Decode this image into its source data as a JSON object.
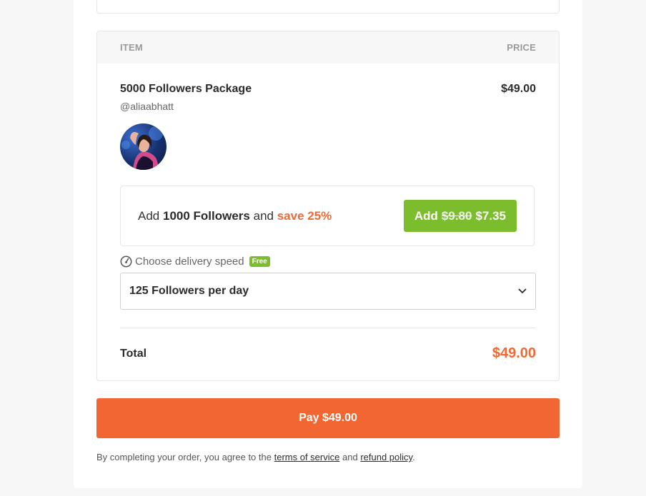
{
  "order": {
    "header": {
      "item_label": "ITEM",
      "price_label": "PRICE"
    },
    "item": {
      "name": "5000 Followers Package",
      "handle": "@aliaabhatt",
      "price": "$49.00"
    },
    "upsell": {
      "prefix": "Add",
      "amount": "1000 Followers",
      "middle": "and",
      "save": "save 25%",
      "button_prefix": "Add",
      "old_price": "$9.80",
      "new_price": "$7.35"
    },
    "delivery": {
      "label": "Choose delivery speed",
      "badge": "Free",
      "selected": "125 Followers per day"
    },
    "total": {
      "label": "Total",
      "value": "$49.00"
    }
  },
  "pay_button": "Pay $49.00",
  "legal": {
    "prefix": "By completing your order, you agree to the",
    "terms": "terms of service",
    "and": "and",
    "refund": "refund policy",
    "suffix": "."
  },
  "colors": {
    "accent_orange": "#f26731",
    "accent_green": "#7cbd2d",
    "save_orange": "#ef6a35"
  },
  "icons": {
    "speed": "speedometer-icon",
    "chevron": "chevron-down-icon",
    "avatar": "profile-avatar"
  }
}
